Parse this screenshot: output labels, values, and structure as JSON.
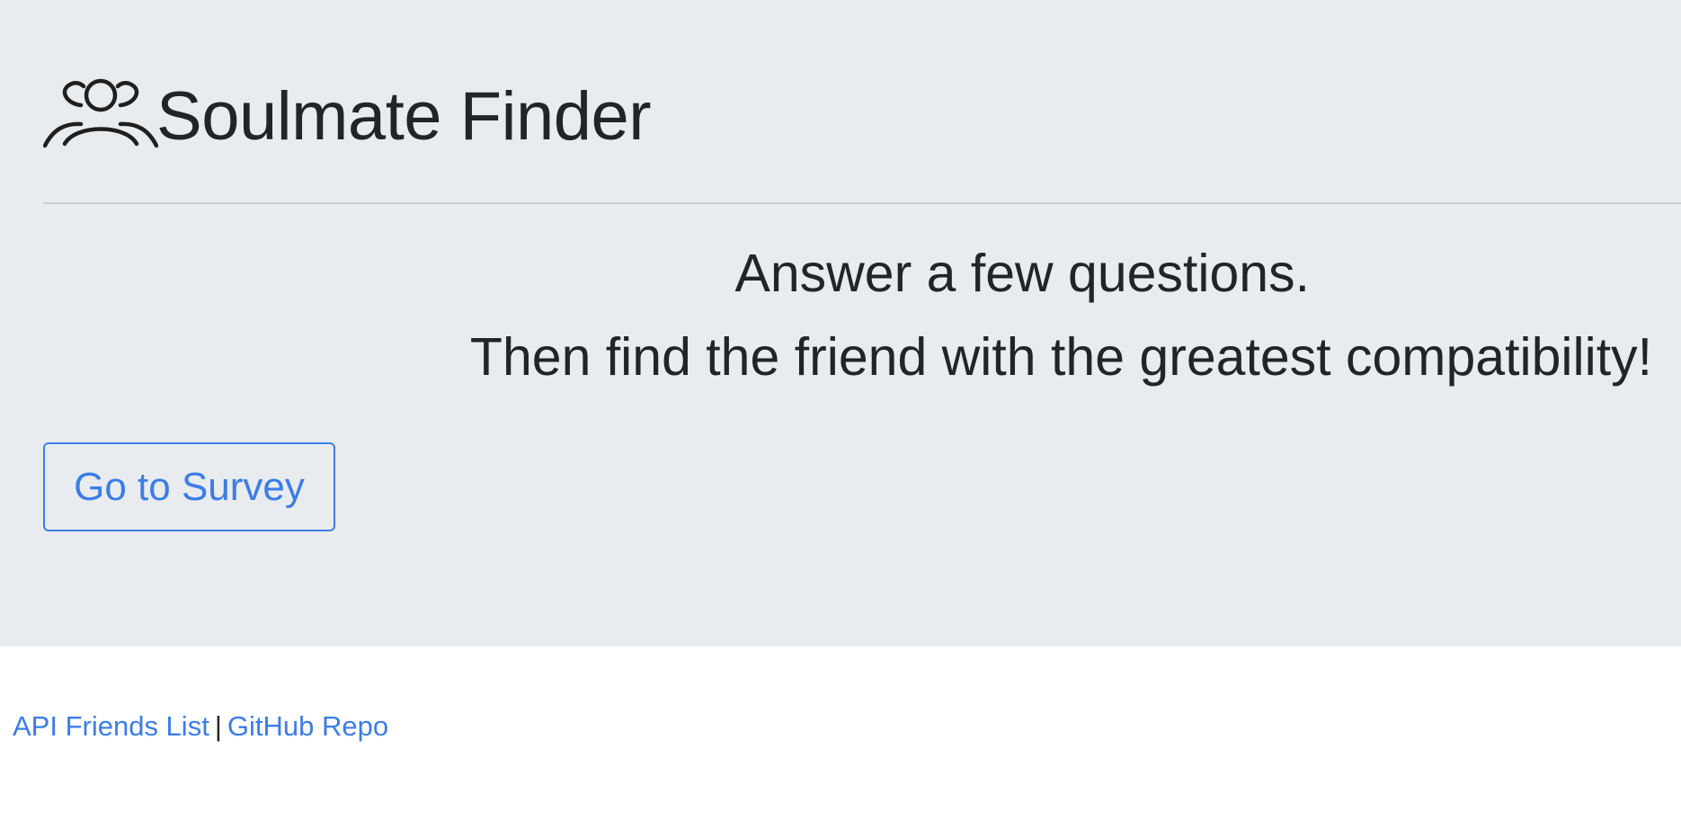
{
  "header": {
    "icon": "people-group-icon",
    "title": "Soulmate Finder"
  },
  "intro": {
    "line1": "Answer a few questions.",
    "line2": "Then find the friend with the greatest compatibility!"
  },
  "actions": {
    "survey_label": "Go to Survey"
  },
  "footer": {
    "links": [
      {
        "label": "API Friends List"
      },
      {
        "label": "GitHub Repo"
      }
    ],
    "separator": "|"
  },
  "colors": {
    "jumbotron_background": "#e9ecef",
    "link_accent": "#3b7de8",
    "text": "#212529"
  }
}
